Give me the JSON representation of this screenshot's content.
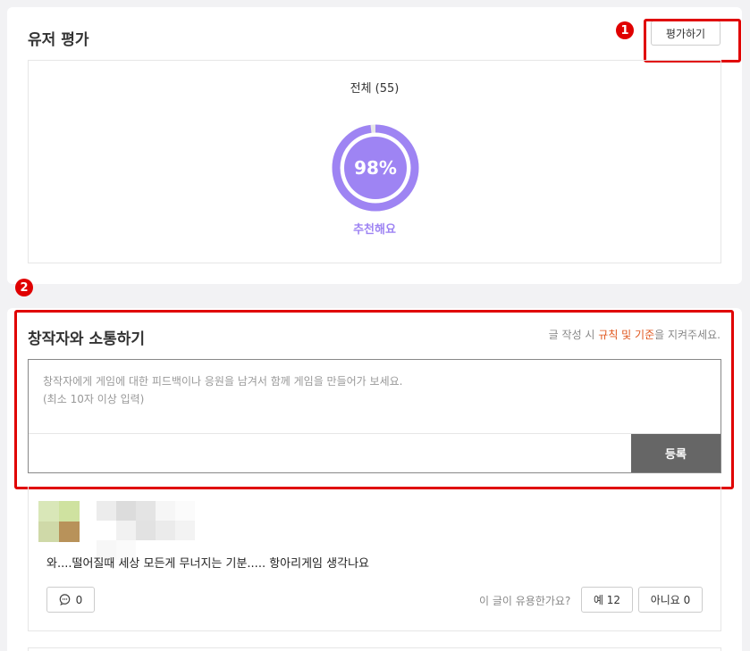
{
  "rating": {
    "title": "유저 평가",
    "rate_button": "평가하기",
    "total_label": "전체 (55)",
    "percent_text": "98%",
    "percent_value": 98,
    "recommend_label": "추천해요",
    "accent_color": "#9e84f3"
  },
  "annotations": {
    "badge_1": "1",
    "badge_2": "2",
    "highlight_color": "#e00000"
  },
  "community": {
    "title": "창작자와 소통하기",
    "guide_prefix": "글 작성 시 ",
    "guide_accent": "규칙 및 기준",
    "guide_suffix": "을 지켜주세요.",
    "input_placeholder": "창작자에게 게임에 대한 피드백이나 응원을 남겨서 함께 게임을 만들어가 보세요.\n(최소 10자 이상 입력)",
    "submit_label": "등록"
  },
  "review": {
    "text": "와....떨어질때 세상 모든게 무너지는 기분..... 항아리게임 생각나요",
    "reply_icon": "comment-icon",
    "reply_count": "0",
    "helpful_question": "이 글이 유용한가요?",
    "yes_label": "예 12",
    "no_label": "아니요 0"
  }
}
